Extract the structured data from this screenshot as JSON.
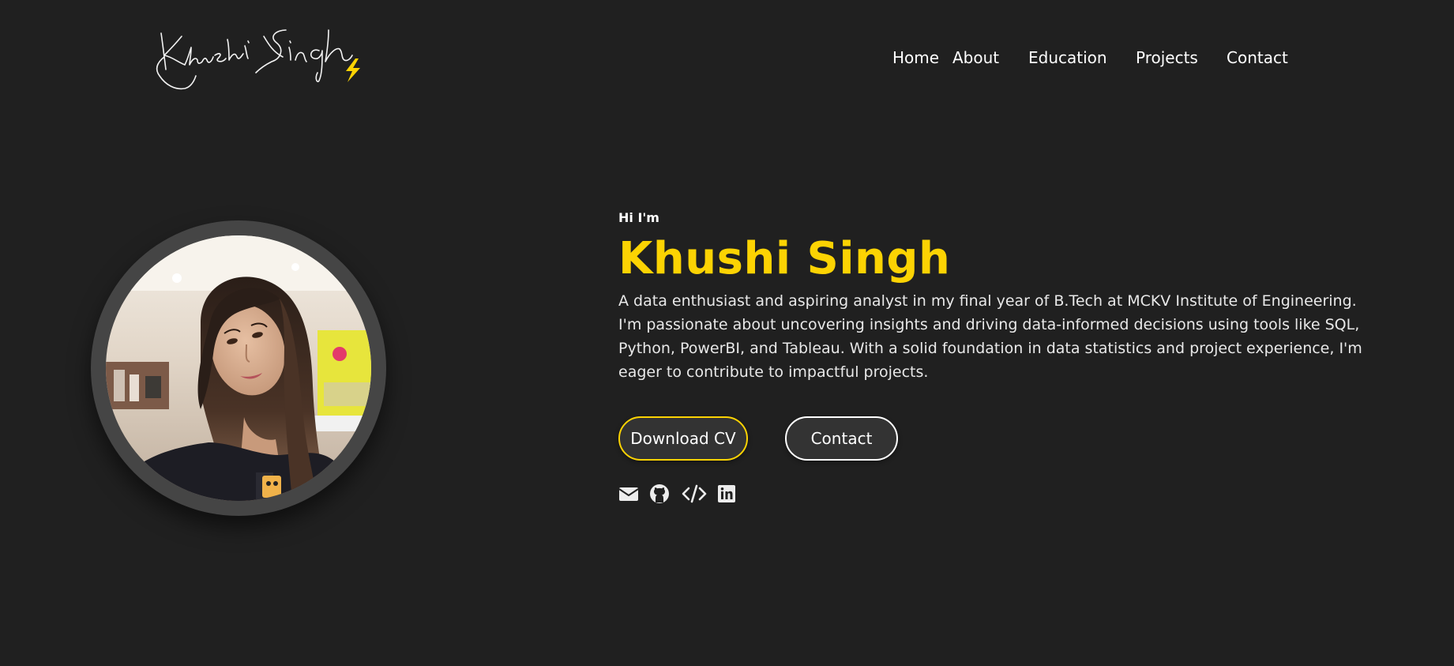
{
  "logo": {
    "text": "Khushi Singh",
    "badge_icon": "lightning-bolt-icon"
  },
  "nav": {
    "items": [
      {
        "label": "Home"
      },
      {
        "label": "About"
      },
      {
        "label": "Education"
      },
      {
        "label": "Projects"
      },
      {
        "label": "Contact"
      }
    ]
  },
  "hero": {
    "greeting": "Hi I'm",
    "name": "Khushi Singh",
    "bio": "A data enthusiast and aspiring analyst in my final year of B.Tech at MCKV Institute of Engineering. I'm passionate about uncovering insights and driving data-informed decisions using tools like SQL, Python, PowerBI, and Tableau. With a solid foundation in data statistics and project experience, I'm eager to contribute to impactful projects.",
    "buttons": {
      "download_cv": "Download CV",
      "contact": "Contact"
    },
    "socials": [
      {
        "icon": "envelope-icon"
      },
      {
        "icon": "github-icon"
      },
      {
        "icon": "code-icon"
      },
      {
        "icon": "linkedin-icon"
      }
    ]
  },
  "colors": {
    "background": "#202020",
    "accent": "#fcd303",
    "text": "#ffffff",
    "button_bg": "#333333",
    "photo_ring": "#454545"
  }
}
